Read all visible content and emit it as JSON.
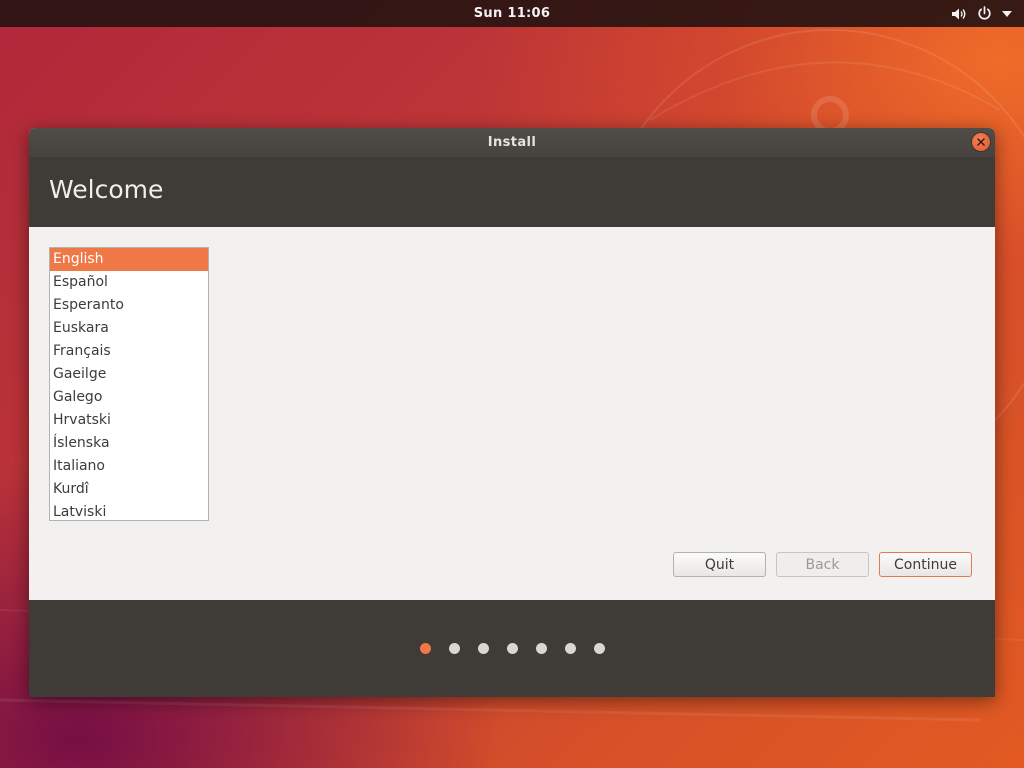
{
  "topbar": {
    "clock": "Sun 11:06",
    "icons": [
      "volume-icon",
      "power-icon",
      "menu-arrow-icon"
    ]
  },
  "window": {
    "title": "Install",
    "header_title": "Welcome",
    "languages": [
      "English",
      "Español",
      "Esperanto",
      "Euskara",
      "Français",
      "Gaeilge",
      "Galego",
      "Hrvatski",
      "Íslenska",
      "Italiano",
      "Kurdî",
      "Latviski"
    ],
    "selected_language": "English",
    "buttons": {
      "quit": "Quit",
      "back": "Back",
      "continue": "Continue"
    },
    "steps": {
      "total": 7,
      "current": 1
    }
  },
  "colors": {
    "accent": "#f07746",
    "panel_dark": "#3f3b36",
    "window_bg": "#f2f1f0"
  }
}
